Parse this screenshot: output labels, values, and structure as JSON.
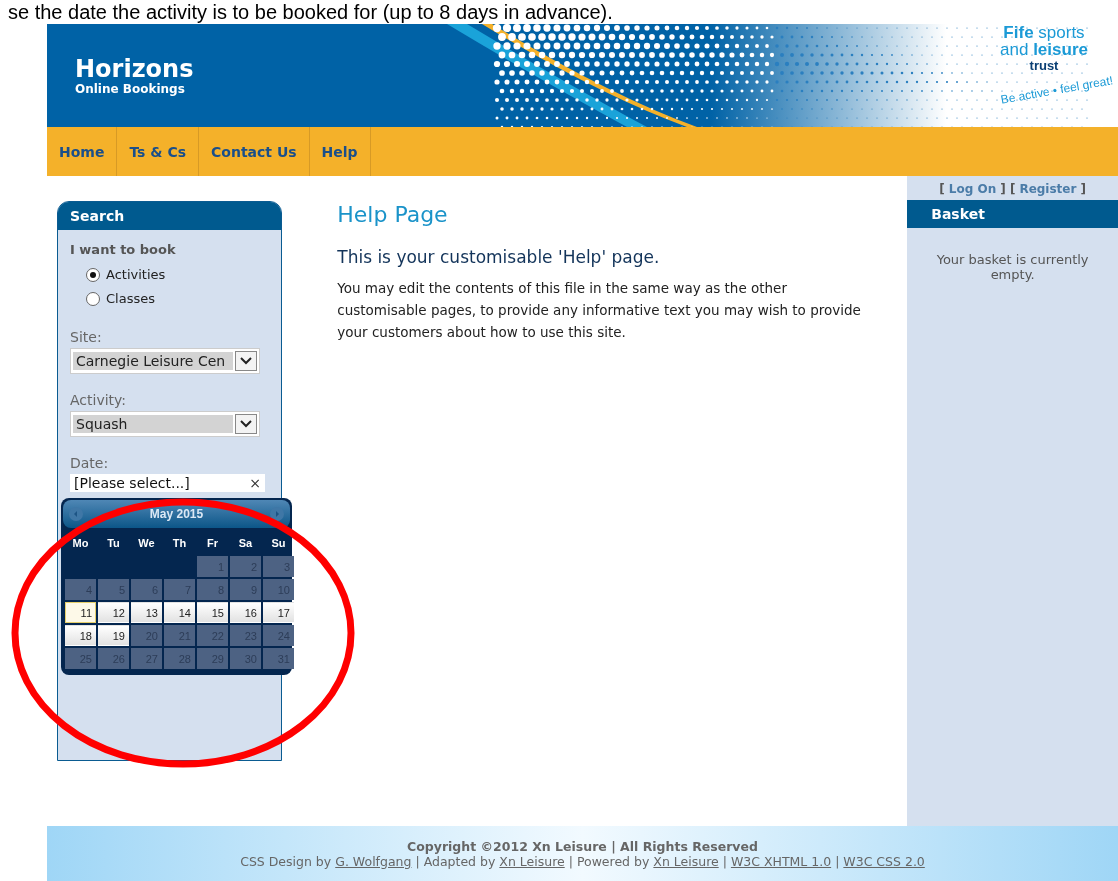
{
  "caption": "se the date the activity is to be booked for (up to 8 days in advance).",
  "header": {
    "title": "Horizons",
    "subtitle": "Online Bookings",
    "logo": {
      "line1_bold": "Fife",
      "line1_rest": "sports",
      "line2_plain": "and",
      "line2_bold": "leisure",
      "line3": "trust",
      "tagline_a": "Be active",
      "tagline_sep": "•",
      "tagline_b": "feel great!"
    }
  },
  "nav": [
    {
      "label": "Home"
    },
    {
      "label": "Ts & Cs"
    },
    {
      "label": "Contact Us"
    },
    {
      "label": "Help"
    }
  ],
  "search": {
    "title": "Search",
    "book_label": "I want to book",
    "options": [
      {
        "label": "Activities",
        "selected": true
      },
      {
        "label": "Classes",
        "selected": false
      }
    ],
    "site": {
      "label": "Site:",
      "value": "Carnegie Leisure Cen"
    },
    "activity": {
      "label": "Activity:",
      "value": "Squash"
    },
    "date": {
      "label": "Date:",
      "value": "[Please select...]",
      "clear": "×"
    },
    "calendar": {
      "month": "May 2015",
      "weekdays": [
        "Mo",
        "Tu",
        "We",
        "Th",
        "Fr",
        "Sa",
        "Su"
      ],
      "weeks": [
        [
          {
            "kind": "blank"
          },
          {
            "kind": "blank"
          },
          {
            "kind": "blank"
          },
          {
            "kind": "blank"
          },
          {
            "kind": "day",
            "day": "1",
            "enabled": false,
            "today": false
          },
          {
            "kind": "day",
            "day": "2",
            "enabled": false,
            "today": false
          },
          {
            "kind": "day",
            "day": "3",
            "enabled": false,
            "today": false
          }
        ],
        [
          {
            "kind": "day",
            "day": "4",
            "enabled": false,
            "today": false
          },
          {
            "kind": "day",
            "day": "5",
            "enabled": false,
            "today": false
          },
          {
            "kind": "day",
            "day": "6",
            "enabled": false,
            "today": false
          },
          {
            "kind": "day",
            "day": "7",
            "enabled": false,
            "today": false
          },
          {
            "kind": "day",
            "day": "8",
            "enabled": false,
            "today": false
          },
          {
            "kind": "day",
            "day": "9",
            "enabled": false,
            "today": false
          },
          {
            "kind": "day",
            "day": "10",
            "enabled": false,
            "today": false
          }
        ],
        [
          {
            "kind": "day",
            "day": "11",
            "enabled": true,
            "today": true
          },
          {
            "kind": "day",
            "day": "12",
            "enabled": true,
            "today": false
          },
          {
            "kind": "day",
            "day": "13",
            "enabled": true,
            "today": false
          },
          {
            "kind": "day",
            "day": "14",
            "enabled": true,
            "today": false
          },
          {
            "kind": "day",
            "day": "15",
            "enabled": true,
            "today": false
          },
          {
            "kind": "day",
            "day": "16",
            "enabled": true,
            "today": false
          },
          {
            "kind": "day",
            "day": "17",
            "enabled": true,
            "today": false
          }
        ],
        [
          {
            "kind": "day",
            "day": "18",
            "enabled": true,
            "today": false
          },
          {
            "kind": "day",
            "day": "19",
            "enabled": true,
            "today": false
          },
          {
            "kind": "day",
            "day": "20",
            "enabled": false,
            "today": false
          },
          {
            "kind": "day",
            "day": "21",
            "enabled": false,
            "today": false
          },
          {
            "kind": "day",
            "day": "22",
            "enabled": false,
            "today": false
          },
          {
            "kind": "day",
            "day": "23",
            "enabled": false,
            "today": false
          },
          {
            "kind": "day",
            "day": "24",
            "enabled": false,
            "today": false
          }
        ],
        [
          {
            "kind": "day",
            "day": "25",
            "enabled": false,
            "today": false
          },
          {
            "kind": "day",
            "day": "26",
            "enabled": false,
            "today": false
          },
          {
            "kind": "day",
            "day": "27",
            "enabled": false,
            "today": false
          },
          {
            "kind": "day",
            "day": "28",
            "enabled": false,
            "today": false
          },
          {
            "kind": "day",
            "day": "29",
            "enabled": false,
            "today": false
          },
          {
            "kind": "day",
            "day": "30",
            "enabled": false,
            "today": false
          },
          {
            "kind": "day",
            "day": "31",
            "enabled": false,
            "today": false
          }
        ]
      ]
    }
  },
  "main": {
    "title": "Help Page",
    "heading": "This is your customisable 'Help' page.",
    "body": "You may edit the contents of this file in the same way as the other customisable pages, to provide any informative text you may wish to provide your customers about how to use this site."
  },
  "account": {
    "open": "[",
    "log_on": "Log On",
    "mid": "] [",
    "register": "Register",
    "close": "]"
  },
  "basket": {
    "title": "Basket",
    "message": "Your basket is currently empty."
  },
  "footer": {
    "copyright": "Copyright ©2012 Xn Leisure | All Rights Reserved",
    "parts": [
      {
        "kind": "text",
        "text": "CSS Design by"
      },
      {
        "kind": "link",
        "text": "G. Wolfgang"
      },
      {
        "kind": "text",
        "text": "| Adapted by"
      },
      {
        "kind": "link",
        "text": "Xn Leisure"
      },
      {
        "kind": "text",
        "text": "| Powered by"
      },
      {
        "kind": "link",
        "text": "Xn Leisure"
      },
      {
        "kind": "text",
        "text": "|"
      },
      {
        "kind": "link",
        "text": "W3C XHTML 1.0"
      },
      {
        "kind": "text",
        "text": "|"
      },
      {
        "kind": "link",
        "text": "W3C CSS 2.0"
      }
    ]
  }
}
